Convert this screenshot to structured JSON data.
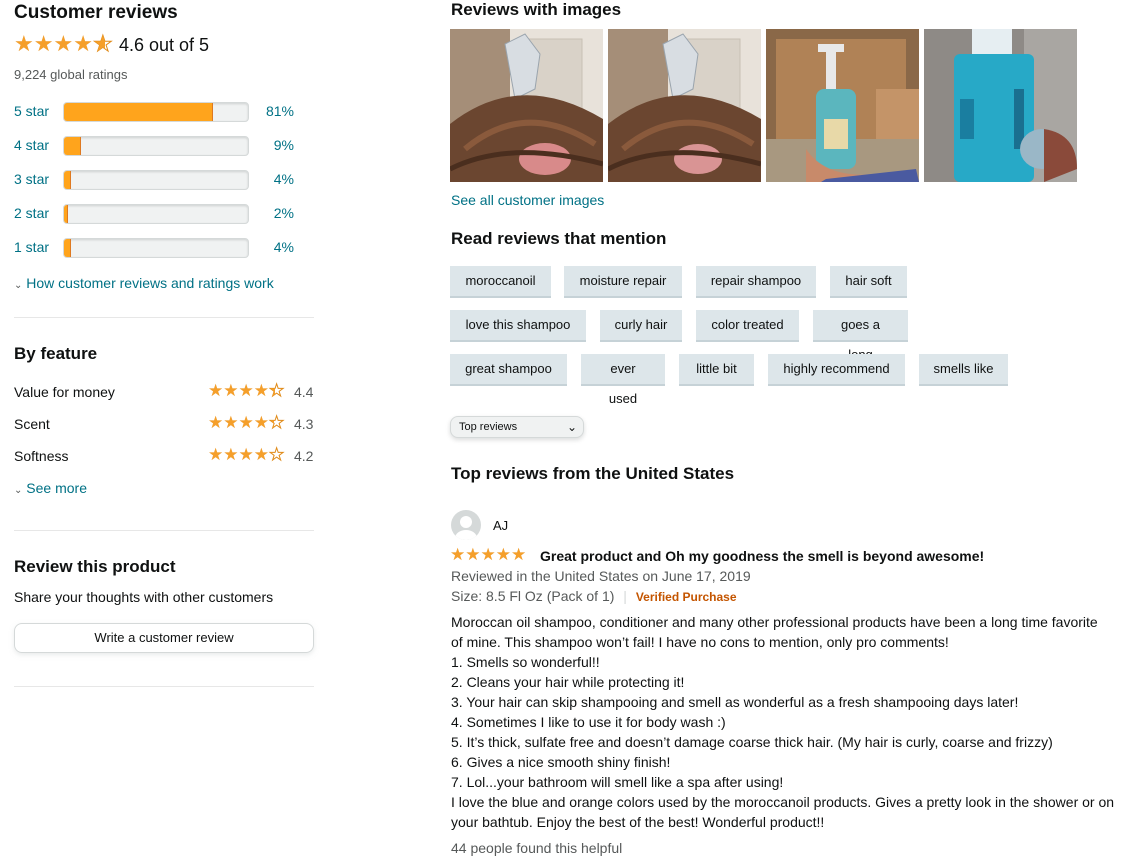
{
  "summary": {
    "title": "Customer reviews",
    "rating_text": "4.6 out of 5",
    "rating_value": 4.6,
    "global_ratings": "9,224 global ratings",
    "histogram": [
      {
        "label": "5 star",
        "percent": "81%",
        "fraction": 0.81
      },
      {
        "label": "4 star",
        "percent": "9%",
        "fraction": 0.09
      },
      {
        "label": "3 star",
        "percent": "4%",
        "fraction": 0.04
      },
      {
        "label": "2 star",
        "percent": "2%",
        "fraction": 0.02
      },
      {
        "label": "1 star",
        "percent": "4%",
        "fraction": 0.04
      }
    ],
    "how_it_works": "How customer reviews and ratings work"
  },
  "features": {
    "title": "By feature",
    "items": [
      {
        "name": "Value for money",
        "rating": "4.4",
        "value": 4.4
      },
      {
        "name": "Scent",
        "rating": "4.3",
        "value": 4.3
      },
      {
        "name": "Softness",
        "rating": "4.2",
        "value": 4.2
      }
    ],
    "see_more": "See more"
  },
  "review_product": {
    "title": "Review this product",
    "subtitle": "Share your thoughts with other customers",
    "button": "Write a customer review"
  },
  "images": {
    "title": "Reviews with images",
    "see_all": "See all customer images"
  },
  "mentions": {
    "title": "Read reviews that mention",
    "chips": [
      "moroccanoil",
      "moisture repair",
      "repair shampoo",
      "hair soft",
      "love this shampoo",
      "curly hair",
      "color treated",
      "goes a long",
      "great shampoo",
      "ever used",
      "little bit",
      "highly recommend",
      "smells like"
    ]
  },
  "sort": {
    "selected": "Top reviews"
  },
  "top_reviews": {
    "title": "Top reviews from the United States",
    "review": {
      "author": "AJ",
      "stars": 5,
      "headline": "Great product and Oh my goodness the smell is beyond awesome!",
      "date": "Reviewed in the United States on June 17, 2019",
      "size": "Size: 8.5 Fl Oz (Pack of 1)",
      "verified": "Verified Purchase",
      "body": [
        "Moroccan oil shampoo, conditioner and many other professional products have been a long time favorite",
        "of mine. This shampoo won’t fail! I have no cons to mention, only pro comments!",
        "1. Smells so wonderful!!",
        "2. Cleans your hair while protecting it!",
        "3. Your hair can skip shampooing and smell as wonderful as a fresh shampooing days later!",
        "4. Sometimes I like to use it for body wash :)",
        "5. It’s thick, sulfate free and doesn’t damage coarse thick hair. (My hair is curly, coarse and frizzy)",
        "6. Gives a nice smooth shiny finish!",
        "7. Lol...your bathroom will smell like a spa after using!",
        "I love the blue and orange colors used by the moroccanoil products. Gives a pretty look in the shower or on",
        "your bathtub. Enjoy the best of the best! Wonderful product!!"
      ],
      "helpful": "44 people found this helpful"
    }
  },
  "colors": {
    "star": "#f59f2a",
    "link": "#007185",
    "bar": "#ffa41c",
    "verified": "#c45500"
  }
}
